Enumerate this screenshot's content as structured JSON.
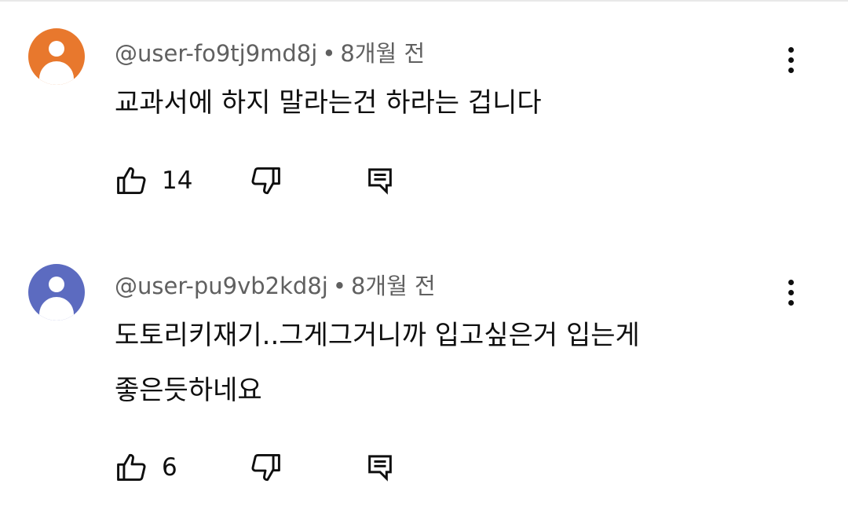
{
  "colors": {
    "avatar_orange": "#E8782D",
    "avatar_blue": "#5C6BC0",
    "meta_text": "#606060",
    "primary_text": "#0F0F0F"
  },
  "icons": {
    "like": "thumb-up-icon",
    "dislike": "thumb-down-icon",
    "reply": "reply-comment-icon",
    "more": "more-vertical-icon"
  },
  "comments": [
    {
      "author": "@user-fo9tj9md8j",
      "separator": "•",
      "time": "8개월 전",
      "text_lines": [
        "교과서에 하지 말라는건 하라는 겁니다"
      ],
      "like_count": "14"
    },
    {
      "author": "@user-pu9vb2kd8j",
      "separator": "•",
      "time": "8개월 전",
      "text_lines": [
        "도토리키재기..그게그거니까 입고싶은거 입는게",
        "좋은듯하네요"
      ],
      "like_count": "6"
    }
  ]
}
